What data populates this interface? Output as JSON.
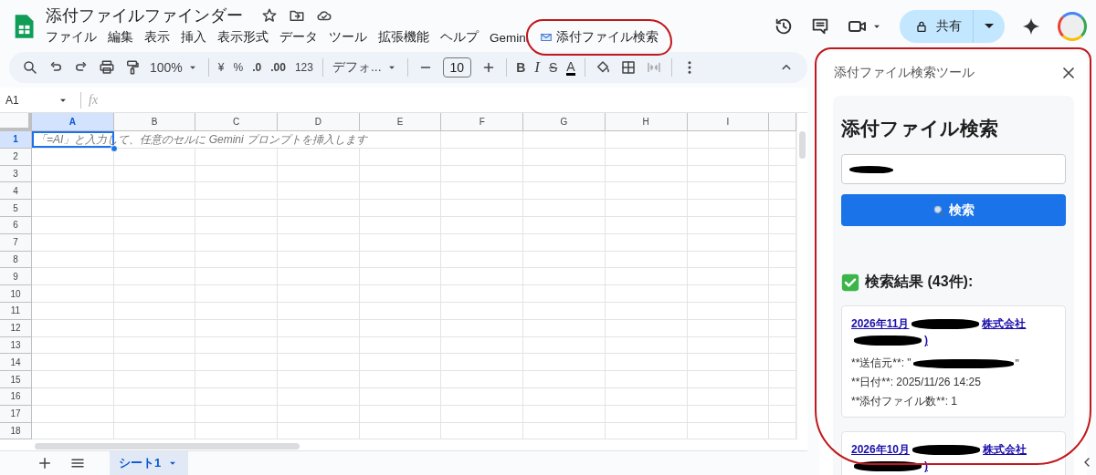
{
  "document": {
    "title": "添付ファイルファインダー"
  },
  "menu": [
    {
      "label": "ファイル",
      "kind": "plain"
    },
    {
      "label": "編集",
      "kind": "plain"
    },
    {
      "label": "表示",
      "kind": "plain"
    },
    {
      "label": "挿入",
      "kind": "plain"
    },
    {
      "label": "表示形式",
      "kind": "plain"
    },
    {
      "label": "データ",
      "kind": "plain"
    },
    {
      "label": "ツール",
      "kind": "plain"
    },
    {
      "label": "拡張機能",
      "kind": "plain"
    },
    {
      "label": "ヘルプ",
      "kind": "plain"
    },
    {
      "label": "Gemini",
      "kind": "plain"
    },
    {
      "label": "添付ファイル検索",
      "kind": "addon"
    }
  ],
  "share_button": {
    "label": "共有"
  },
  "toolbar": {
    "zoom": "100%",
    "currency": "¥",
    "percent": "%",
    "decrease_decimal": ".0",
    "increase_decimal": ".00",
    "number_format": "123",
    "font": "デフォ...",
    "font_size": "10",
    "bold": "B",
    "italic": "I",
    "strikethrough": "S",
    "text_color": "A"
  },
  "formula_bar": {
    "name_box": "A1",
    "fx": "fx"
  },
  "grid": {
    "columns": [
      {
        "label": "A",
        "selected": true
      },
      {
        "label": "B",
        "selected": false
      },
      {
        "label": "C",
        "selected": false
      },
      {
        "label": "D",
        "selected": false
      },
      {
        "label": "E",
        "selected": false
      },
      {
        "label": "F",
        "selected": false
      },
      {
        "label": "G",
        "selected": false
      },
      {
        "label": "H",
        "selected": false
      },
      {
        "label": "I",
        "selected": false
      }
    ],
    "rows": [
      {
        "label": "1",
        "selected": true
      },
      {
        "label": "2",
        "selected": false
      },
      {
        "label": "3",
        "selected": false
      },
      {
        "label": "4",
        "selected": false
      },
      {
        "label": "5",
        "selected": false
      },
      {
        "label": "6",
        "selected": false
      },
      {
        "label": "7",
        "selected": false
      },
      {
        "label": "8",
        "selected": false
      },
      {
        "label": "9",
        "selected": false
      },
      {
        "label": "10",
        "selected": false
      },
      {
        "label": "11",
        "selected": false
      },
      {
        "label": "12",
        "selected": false
      },
      {
        "label": "13",
        "selected": false
      },
      {
        "label": "14",
        "selected": false
      },
      {
        "label": "15",
        "selected": false
      },
      {
        "label": "16",
        "selected": false
      },
      {
        "label": "17",
        "selected": false
      },
      {
        "label": "18",
        "selected": false
      }
    ],
    "cell_hint": "「=AI」と入力して、任意のセルに Gemini プロンプトを挿入します"
  },
  "sheet_tabs": [
    {
      "label": "シート1",
      "selected": true
    }
  ],
  "sidebar": {
    "title": "添付ファイル検索ツール",
    "heading": "添付ファイル検索",
    "search_button": "検索",
    "results_heading": "検索結果 (43件):",
    "results": [
      {
        "title_parts": [
          "2026年11月",
          "株式会社",
          ")"
        ],
        "lines": [
          "**送信元**: \"",
          "**日付**: 2025/11/26 14:25",
          "**添付ファイル数**: 1"
        ],
        "sender_end": "\""
      },
      {
        "title_parts": [
          "2026年10月",
          "株式会社",
          ")"
        ]
      }
    ]
  }
}
